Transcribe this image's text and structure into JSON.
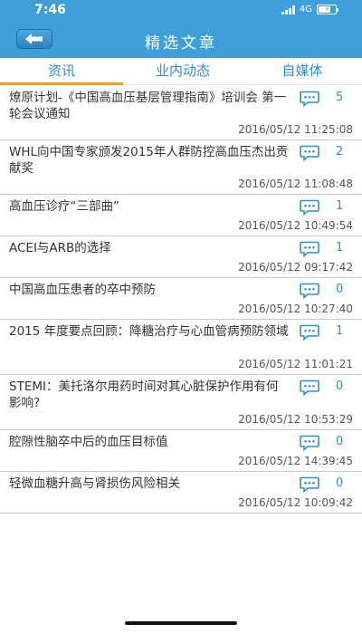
{
  "status": {
    "time": "7:46",
    "network": "4G",
    "battery_level": 0.7
  },
  "nav": {
    "title": "精选文章",
    "back_icon": "back-arrow-icon"
  },
  "tabs": [
    {
      "label": "资讯",
      "active": true
    },
    {
      "label": "业内动态",
      "active": false
    },
    {
      "label": "自媒体",
      "active": false
    }
  ],
  "articles": [
    {
      "title": "燎原计划-《中国高血压基层管理指南》培训会 第一轮会议通知",
      "date": "2016/05/12 11:25:08",
      "comments": "5"
    },
    {
      "title": "WHL向中国专家颁发2015年人群防控高血压杰出贡献奖",
      "date": "2016/05/12 11:08:48",
      "comments": "2"
    },
    {
      "title": "高血压诊疗“三部曲”",
      "date": "2016/05/12 10:49:54",
      "comments": "1"
    },
    {
      "title": "ACEI与ARB的选择",
      "date": "2016/05/12 09:17:42",
      "comments": "1"
    },
    {
      "title": "中国高血压患者的卒中预防",
      "date": "2016/05/12 10:27:40",
      "comments": "0"
    },
    {
      "title": "2015 年度要点回顾：降糖治疗与心血管病预防领域",
      "date": "2016/05/12 11:01:21",
      "comments": "1"
    },
    {
      "title": "STEMI：美托洛尔用药时间对其心脏保护作用有何影响?",
      "date": "2016/05/12 10:53:29",
      "comments": "0"
    },
    {
      "title": "腔隙性脑卒中后的血压目标值",
      "date": "2016/05/12 14:39:45",
      "comments": "0"
    },
    {
      "title": "轻微血糖升高与肾损伤风险相关",
      "date": "2016/05/12 10:09:42",
      "comments": "0"
    }
  ],
  "colors": {
    "primary": "#3f9fd8",
    "accent": "#2f8fd0",
    "tab_indicator": "#f2a21a"
  }
}
